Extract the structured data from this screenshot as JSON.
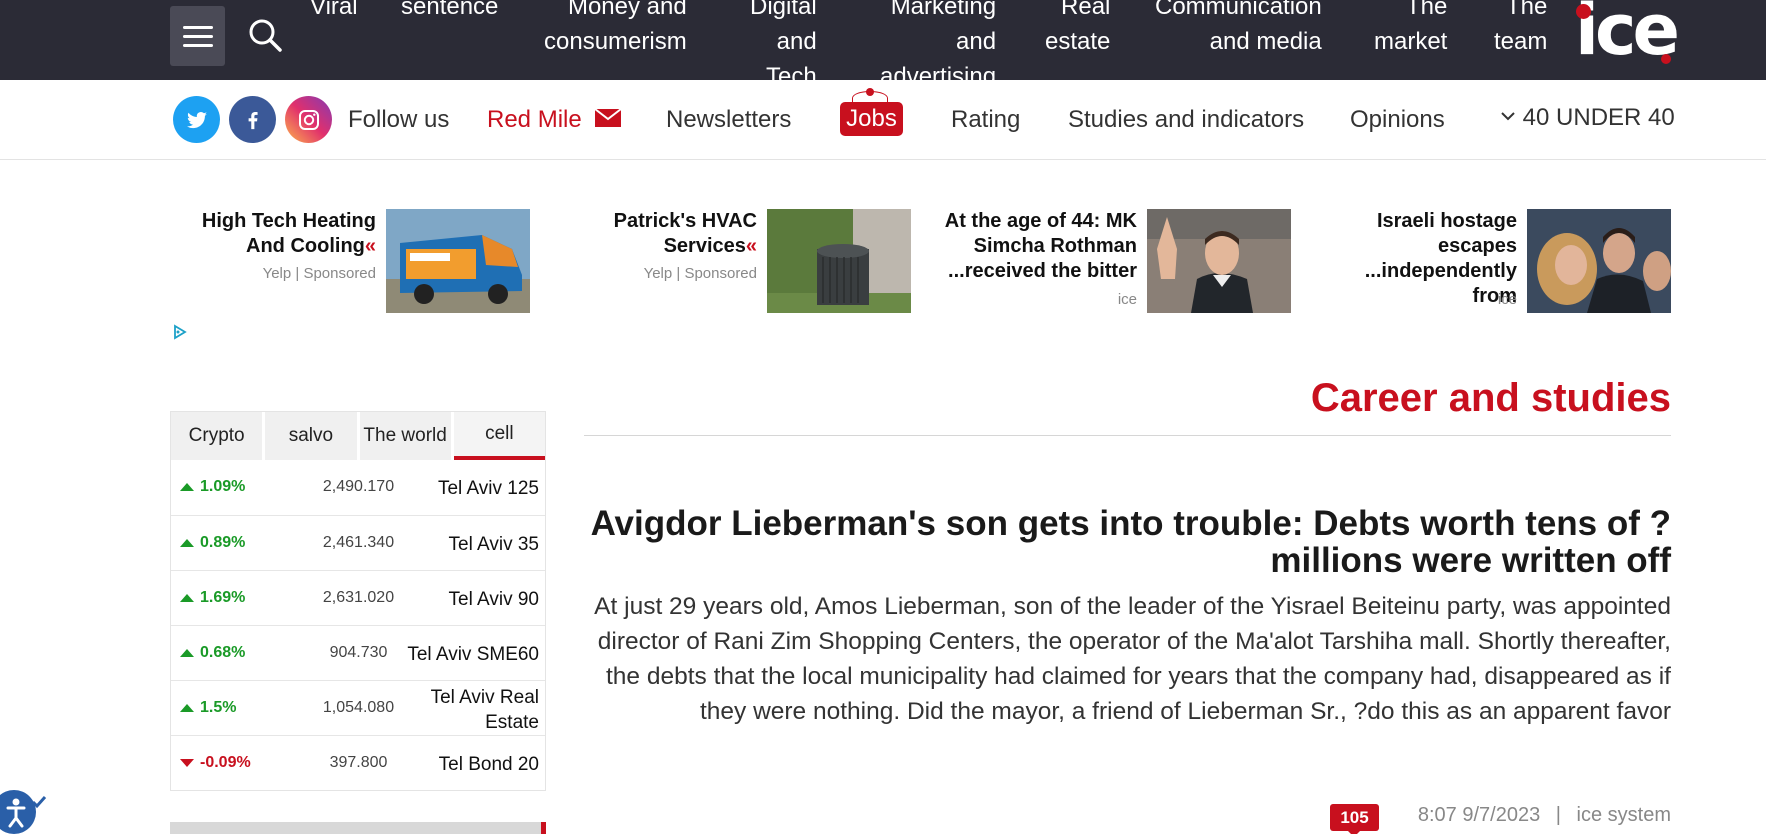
{
  "topbar": {
    "nav": [
      {
        "line1": "Viral",
        "line2": ""
      },
      {
        "line1": "sentence",
        "line2": ""
      },
      {
        "line1": "Money and",
        "line2": "consumerism"
      },
      {
        "line1": "Digital",
        "line2": "and",
        "line3": "Tech"
      },
      {
        "line1": "Marketing",
        "line2": "and",
        "line3": "advertising"
      },
      {
        "line1": "Real",
        "line2": "estate"
      },
      {
        "line1": "Communication",
        "line2": "and media"
      },
      {
        "line1": "The",
        "line2": "market"
      },
      {
        "line1": "The",
        "line2": "team"
      }
    ],
    "logo_text": "ice",
    "menu_icon": "hamburger-icon",
    "search_icon": "search-icon"
  },
  "subnav": {
    "follow_us": "Follow us",
    "red_mile": "Red Mile",
    "newsletters": "Newsletters",
    "jobs": "Jobs",
    "rating": "Rating",
    "studies": "Studies and indicators",
    "opinions": "Opinions",
    "forty_under_forty": "40 UNDER 40"
  },
  "promos": [
    {
      "title": "High Tech Heating And Cooling",
      "arrow": "«",
      "source": "Yelp | Sponsored"
    },
    {
      "title": "Patrick's HVAC Services",
      "arrow": "«",
      "source": "Yelp | Sponsored"
    },
    {
      "title": "At the age of 44: MK Simcha Rothman ...received the bitter",
      "arrow": "",
      "source": "ice"
    },
    {
      "title": "Israeli hostage escapes ...independently from",
      "arrow": "",
      "source": "ice"
    }
  ],
  "market": {
    "tabs": [
      "Crypto",
      "salvo",
      "The world",
      "cell"
    ],
    "active_tab": "cell",
    "rows": [
      {
        "change": "1.09%",
        "direction": "up",
        "value": "2,490.170",
        "name": "Tel Aviv 125"
      },
      {
        "change": "0.89%",
        "direction": "up",
        "value": "2,461.340",
        "name": "Tel Aviv 35"
      },
      {
        "change": "1.69%",
        "direction": "up",
        "value": "2,631.020",
        "name": "Tel Aviv 90"
      },
      {
        "change": "0.68%",
        "direction": "up",
        "value": "904.730",
        "name": "Tel Aviv SME60"
      },
      {
        "change": "1.5%",
        "direction": "up",
        "value": "1,054.080",
        "name": "Tel Aviv Real Estate"
      },
      {
        "change": "-0.09%",
        "direction": "down",
        "value": "397.800",
        "name": "Tel Bond 20"
      }
    ]
  },
  "article": {
    "section": "Career and studies",
    "headline": "Avigdor Lieberman's son gets into trouble: Debts worth tens of ?millions were written off",
    "summary": "At just 29 years old, Amos Lieberman, son of the leader of the Yisrael Beiteinu party, was appointed director of Rani Zim Shopping Centers, the operator of the Ma'alot Tarshiha mall. Shortly thereafter, the debts that the local municipality had claimed for years that the company had, disappeared as if they were nothing. Did the mayor, a friend of Lieberman Sr., ?do this as an apparent favor",
    "comments": "105",
    "datetime": "8:07 9/7/2023",
    "separator": "|",
    "author": "ice system"
  },
  "colors": {
    "brand_red": "#c8101e",
    "topbar_bg": "#2b2b36",
    "up_green": "#1a9a27"
  }
}
